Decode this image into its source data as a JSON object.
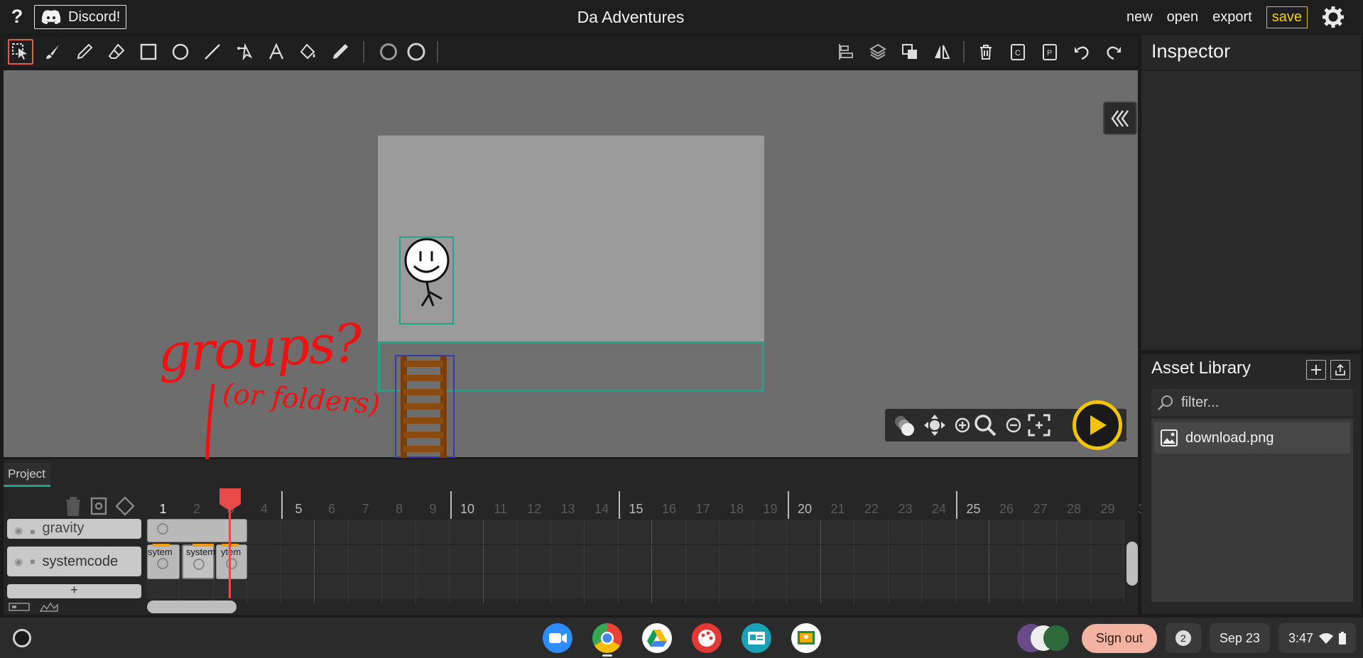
{
  "topbar": {
    "help": "?",
    "discord": "Discord!",
    "title": "Da Adventures",
    "menu": {
      "new": "new",
      "open": "open",
      "export": "export",
      "save": "save"
    }
  },
  "toolbar": {
    "tools": [
      "select-icon",
      "brush-icon",
      "pencil-icon",
      "eraser-icon",
      "rectangle-icon",
      "ellipse-icon",
      "line-icon",
      "path-icon",
      "text-icon",
      "fill-bucket-icon",
      "eyedropper-icon"
    ],
    "right_tools": [
      "align-icon",
      "layers-icon",
      "arrange-icon",
      "flip-icon",
      "delete-icon",
      "copy-clip-icon",
      "copy-page-icon",
      "undo-icon",
      "redo-icon"
    ],
    "fill_color": "#1a1a1a",
    "stroke_color": "#1a1a1a"
  },
  "annotation": {
    "main": "groups?",
    "sub": "(or folders)"
  },
  "timeline": {
    "tab": "Project",
    "frames": [
      "1",
      "2",
      "3",
      "4",
      "5",
      "6",
      "7",
      "8",
      "9",
      "10",
      "11",
      "12",
      "13",
      "14",
      "15",
      "16",
      "17",
      "18",
      "19",
      "20",
      "21",
      "22",
      "23",
      "24",
      "25",
      "26",
      "27",
      "28",
      "29",
      "3"
    ],
    "layers": [
      {
        "name": "gravity"
      },
      {
        "name": "systemcode"
      }
    ],
    "clips": {
      "left": "sytem",
      "center": "system",
      "right": "ytem"
    },
    "add_layer": "+"
  },
  "inspector": {
    "title": "Inspector"
  },
  "asset_library": {
    "title": "Asset Library",
    "filter_placeholder": "filter...",
    "items": [
      {
        "name": "download.png"
      }
    ]
  },
  "shelf": {
    "sign_out": "Sign out",
    "notifications": "2",
    "date": "Sep 23",
    "time": "3:47",
    "apps": [
      "zoom-icon",
      "chrome-icon",
      "drive-icon",
      "canvas-paint-icon",
      "classroom-id-icon",
      "google-classroom-icon"
    ]
  },
  "colors": {
    "accent": "#1fa48a",
    "save": "#f5d400",
    "annotation": "#f21010",
    "playhead": "#e84a4a"
  }
}
